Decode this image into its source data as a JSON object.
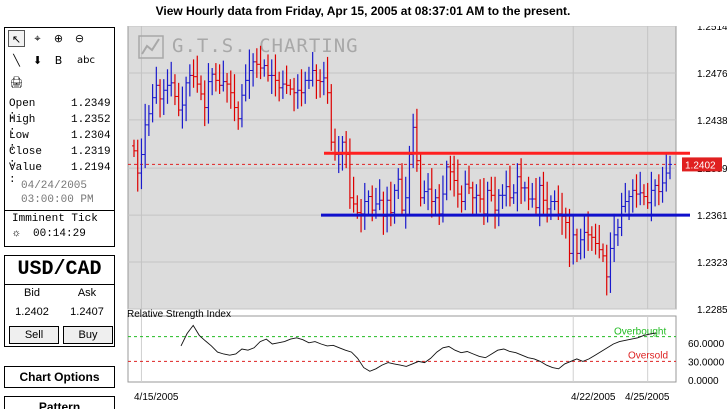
{
  "header": {
    "title": "View Hourly  data from Friday, Apr 15, 2005 at 08:37:01 AM to the present."
  },
  "tools": [
    {
      "name": "select-arrow-icon",
      "glyph": "↖",
      "selected": true
    },
    {
      "name": "crosshair-icon",
      "glyph": "⌖"
    },
    {
      "name": "zoom-in-icon",
      "glyph": "⊕"
    },
    {
      "name": "zoom-out-icon",
      "glyph": "⊖"
    },
    {
      "name": "line-tool-icon",
      "glyph": "╲"
    },
    {
      "name": "arrow-down-icon",
      "glyph": "⬇"
    },
    {
      "name": "bookmark-icon",
      "glyph": "B"
    },
    {
      "name": "text-tool-icon",
      "glyph": "abc"
    },
    {
      "name": "print-icon",
      "glyph": "🖨"
    }
  ],
  "quote": {
    "open_label": "Open  :",
    "open": "1.2349",
    "high_label": "High  :",
    "high": "1.2352",
    "low_label": "Low   :",
    "low": "1.2304",
    "close_label": "Close :",
    "close": "1.2319",
    "value_label": "Value :",
    "value": "1.2194",
    "date": "04/24/2005",
    "time": "03:00:00 PM",
    "imminent_label": "Imminent Tick",
    "countdown": "00:14:29"
  },
  "fx": {
    "pair": "USD/CAD",
    "bid_label": "Bid",
    "ask_label": "Ask",
    "bid": "1.2402",
    "ask": "1.2407",
    "sell_label": "Sell",
    "buy_label": "Buy"
  },
  "menu": {
    "chart_options": "Chart Options",
    "pattern": "Pattern"
  },
  "chart_data": [
    {
      "type": "ohlc",
      "watermark": "G.T.S. CHARTING",
      "y_ticks": [
        "1.2514",
        "1.2476",
        "1.2438",
        "1.2399",
        "1.2361",
        "1.2323",
        "1.2285"
      ],
      "ylim": [
        1.2285,
        1.2514
      ],
      "x_ticks": [
        {
          "label": "4/15/2005",
          "index": 2
        },
        {
          "label": "4/22/2005",
          "index": 118
        },
        {
          "label": "4/25/2005",
          "index": 138
        }
      ],
      "last_price": "1.2402",
      "resistance": 1.2411,
      "support": 1.2361,
      "colors": {
        "up": "#1a1acc",
        "down": "#dd0000",
        "resistance": "#ff2020",
        "support": "#1010cc",
        "last": "#e02020",
        "bg": "#dcdcdc"
      },
      "closes": [
        1.2413,
        1.2395,
        1.241,
        1.2434,
        1.2443,
        1.2456,
        1.2466,
        1.2455,
        1.2462,
        1.2466,
        1.2468,
        1.2457,
        1.2446,
        1.245,
        1.2468,
        1.2474,
        1.2473,
        1.2467,
        1.2459,
        1.2448,
        1.2469,
        1.2475,
        1.247,
        1.2466,
        1.2469,
        1.2467,
        1.246,
        1.2448,
        1.2439,
        1.2458,
        1.247,
        1.2478,
        1.2485,
        1.2483,
        1.248,
        1.2482,
        1.2474,
        1.2474,
        1.247,
        1.2464,
        1.2467,
        1.2466,
        1.2463,
        1.246,
        1.2462,
        1.246,
        1.247,
        1.247,
        1.2478,
        1.247,
        1.2469,
        1.2472,
        1.246,
        1.242,
        1.241,
        1.241,
        1.242,
        1.241,
        1.2375,
        1.237,
        1.2363,
        1.2362,
        1.2372,
        1.2376,
        1.2365,
        1.237,
        1.2373,
        1.236,
        1.2373,
        1.2363,
        1.2381,
        1.239,
        1.2365,
        1.2375,
        1.241,
        1.2432,
        1.2405,
        1.2375,
        1.238,
        1.2382,
        1.2372,
        1.2375,
        1.2362,
        1.2378,
        1.24,
        1.2396,
        1.2389,
        1.2378,
        1.2372,
        1.2386,
        1.2383,
        1.2375,
        1.2377,
        1.2374,
        1.2362,
        1.2381,
        1.2377,
        1.2365,
        1.2377,
        1.2377,
        1.2384,
        1.2375,
        1.2379,
        1.2392,
        1.2383,
        1.2383,
        1.2374,
        1.2374,
        1.2367,
        1.2385,
        1.2373,
        1.2366,
        1.2372,
        1.2372,
        1.2362,
        1.236,
        1.2355,
        1.233,
        1.2345,
        1.233,
        1.2341,
        1.2347,
        1.2345,
        1.2343,
        1.2338,
        1.2333,
        1.2328,
        1.2311,
        1.2334,
        1.2345,
        1.2351,
        1.2368,
        1.2372,
        1.2376,
        1.2381,
        1.2378,
        1.2379,
        1.2376,
        1.2371,
        1.2381,
        1.2385,
        1.238,
        1.2387,
        1.2395,
        1.2402
      ]
    },
    {
      "type": "line",
      "title": "Relative Strength Index",
      "y_ticks": [
        "60.0000",
        "30.0000",
        "0.0000"
      ],
      "ylim": [
        0,
        100
      ],
      "overbought": 70,
      "oversold": 30,
      "overbought_label": "Overbought",
      "oversold_label": "Oversold",
      "values": [
        55,
        75,
        88,
        72,
        63,
        55,
        45,
        42,
        40,
        42,
        50,
        48,
        52,
        62,
        66,
        58,
        60,
        62,
        66,
        68,
        65,
        60,
        62,
        58,
        55,
        56,
        52,
        48,
        45,
        35,
        20,
        14,
        18,
        24,
        28,
        26,
        24,
        22,
        26,
        30,
        28,
        35,
        45,
        52,
        54,
        48,
        44,
        46,
        42,
        38,
        36,
        42,
        48,
        50,
        46,
        44,
        40,
        36,
        34,
        30,
        24,
        20,
        18,
        26,
        30,
        34,
        30,
        34,
        40,
        46,
        52,
        58,
        62,
        64,
        66,
        68,
        72,
        74,
        76
      ]
    }
  ]
}
